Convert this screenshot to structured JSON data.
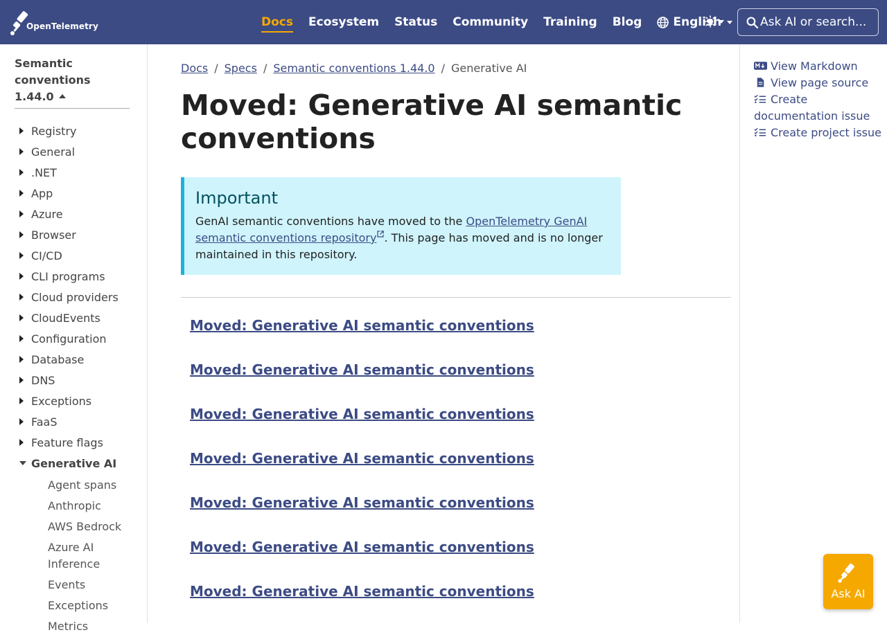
{
  "brand": {
    "name": "OpenTelemetry"
  },
  "nav": {
    "links": [
      "Docs",
      "Ecosystem",
      "Status",
      "Community",
      "Training",
      "Blog"
    ],
    "active": "Docs",
    "language": "English"
  },
  "search": {
    "placeholder": "Ask AI or search..."
  },
  "sidebar": {
    "title": "Semantic conventions 1.44.0",
    "items": [
      "Registry",
      "General",
      ".NET",
      "App",
      "Azure",
      "Browser",
      "CI/CD",
      "CLI programs",
      "Cloud providers",
      "CloudEvents",
      "Configuration",
      "Database",
      "DNS",
      "Exceptions",
      "FaaS",
      "Feature flags",
      "Generative AI"
    ],
    "open_item": "Generative AI",
    "subitems": [
      "Agent spans",
      "Anthropic",
      "AWS Bedrock",
      "Azure AI Inference",
      "Events",
      "Exceptions",
      "Metrics"
    ]
  },
  "breadcrumb": {
    "items": [
      "Docs",
      "Specs",
      "Semantic conventions 1.44.0"
    ],
    "current": "Generative AI"
  },
  "page": {
    "title": "Moved: Generative AI semantic conventions",
    "alert": {
      "title": "Important",
      "before": "GenAI semantic conventions have moved to the ",
      "link": "OpenTelemetry GenAI semantic conventions repository",
      "after": ". This page has moved and is no longer maintained in this repository."
    },
    "moved_links": [
      "Moved: Generative AI semantic conventions",
      "Moved: Generative AI semantic conventions",
      "Moved: Generative AI semantic conventions",
      "Moved: Generative AI semantic conventions",
      "Moved: Generative AI semantic conventions",
      "Moved: Generative AI semantic conventions",
      "Moved: Generative AI semantic conventions"
    ]
  },
  "page_actions": {
    "view_markdown": "View Markdown",
    "view_source": "View page source",
    "create_doc_issue": "Create documentation issue",
    "create_project_issue": "Create project issue"
  },
  "ask_ai": {
    "label": "Ask AI"
  },
  "colors": {
    "navbar": "#3c4b84",
    "accent": "#f5a800",
    "link": "#3c4b84",
    "alert_bg": "#cff4fc",
    "alert_border": "#1bb3d6"
  }
}
